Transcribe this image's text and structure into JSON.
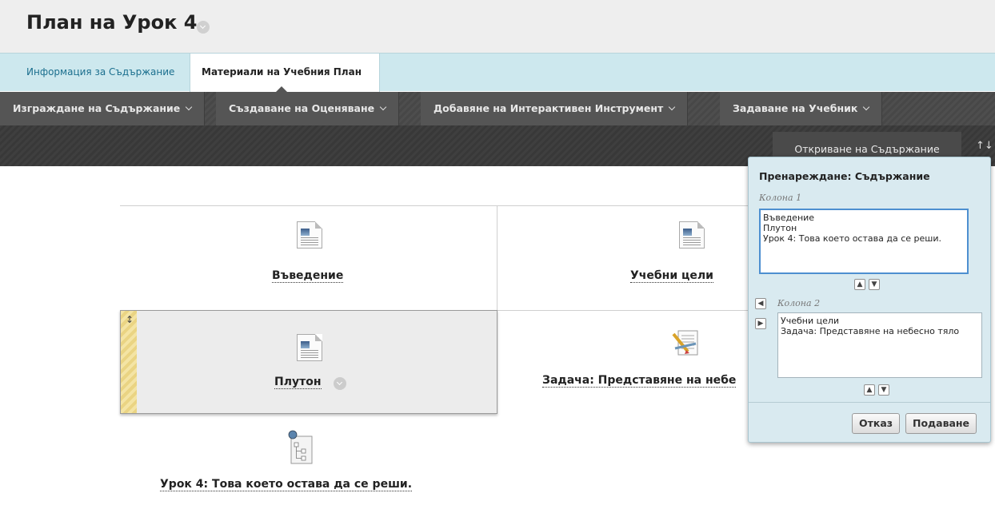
{
  "page": {
    "title": "План на Урок 4"
  },
  "tabs": [
    {
      "label": "Информация за Съдържание",
      "active": false
    },
    {
      "label": "Материали на Учебния План",
      "active": true
    }
  ],
  "action_bar": {
    "items": [
      {
        "label": "Изграждане на Съдържание"
      },
      {
        "label": "Създаване на Оценяване"
      },
      {
        "label": "Добавяне на Интерактивен Инструмент"
      },
      {
        "label": "Задаване на Учебник"
      }
    ]
  },
  "sub_bar": {
    "discover_label": "Откриване на Съдържание",
    "sort_glyph": "↑↓"
  },
  "content_items": [
    {
      "title": "Въведение",
      "icon": "document-icon"
    },
    {
      "title": "Учебни цели",
      "icon": "document-icon"
    },
    {
      "title": "Плутон",
      "icon": "document-icon"
    },
    {
      "title": "Задача: Представяне на небесно тяло",
      "visible_title": "Задача: Представяне на небе",
      "icon": "assignment-icon"
    },
    {
      "title": "Урок 4: Това което остава да се реши.",
      "icon": "lesson-plan-icon"
    }
  ],
  "reorder_panel": {
    "title": "Пренареждане: Съдържание",
    "column1_label": "Колона 1",
    "column1_items": [
      "Въведение",
      "Плутон",
      "Урок 4: Това което остава да се реши."
    ],
    "column2_label": "Колона 2",
    "column2_items": [
      "Учебни цели",
      "Задача: Представяне на небесно тяло"
    ],
    "cancel_label": "Отказ",
    "submit_label": "Подаване"
  },
  "colors": {
    "tab_bar": "#cde8ee",
    "action_bar": "#555555",
    "panel_bg": "#d9eaf0",
    "link": "#1b6f8e"
  }
}
